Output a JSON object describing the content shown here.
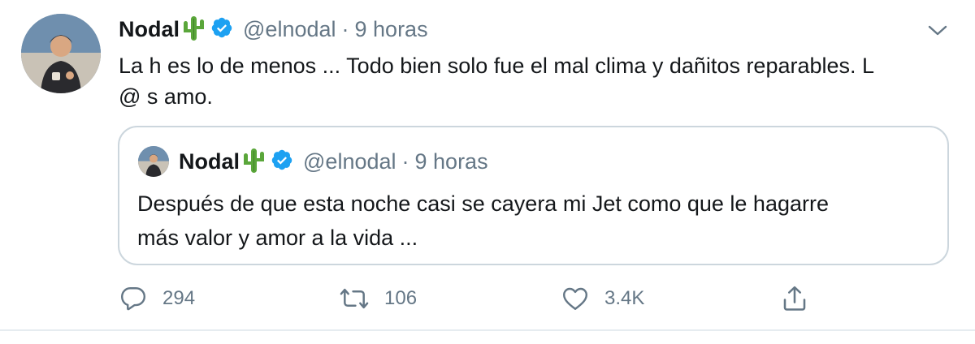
{
  "tweet": {
    "author": {
      "display_name": "Nodal",
      "emoji_icon": "cactus-icon",
      "verified_icon": "verified-badge-icon",
      "handle": "@elnodal"
    },
    "time": "9 horas",
    "separator": "·",
    "text_line1": "La h es lo de menos ... Todo bien solo fue el mal clima y dañitos reparables. L",
    "text_line2": "@ s amo.",
    "menu_icon": "chevron-down-icon"
  },
  "quoted_tweet": {
    "author": {
      "display_name": "Nodal",
      "emoji_icon": "cactus-icon",
      "verified_icon": "verified-badge-icon",
      "handle": "@elnodal"
    },
    "time": "9 horas",
    "separator": "·",
    "text_line1": "Después de que esta noche casi se cayera mi Jet como que le hagarre",
    "text_line2": "más valor y amor a la vida ..."
  },
  "actions": {
    "reply": {
      "icon": "reply-icon",
      "count": "294"
    },
    "retweet": {
      "icon": "retweet-icon",
      "count": "106"
    },
    "like": {
      "icon": "heart-icon",
      "count": "3.4K"
    },
    "share": {
      "icon": "share-icon"
    }
  },
  "colors": {
    "text": "#14171a",
    "secondary": "#657786",
    "verified": "#1da1f2",
    "border": "#ccd6dd",
    "cactus": "#5aa63a"
  }
}
